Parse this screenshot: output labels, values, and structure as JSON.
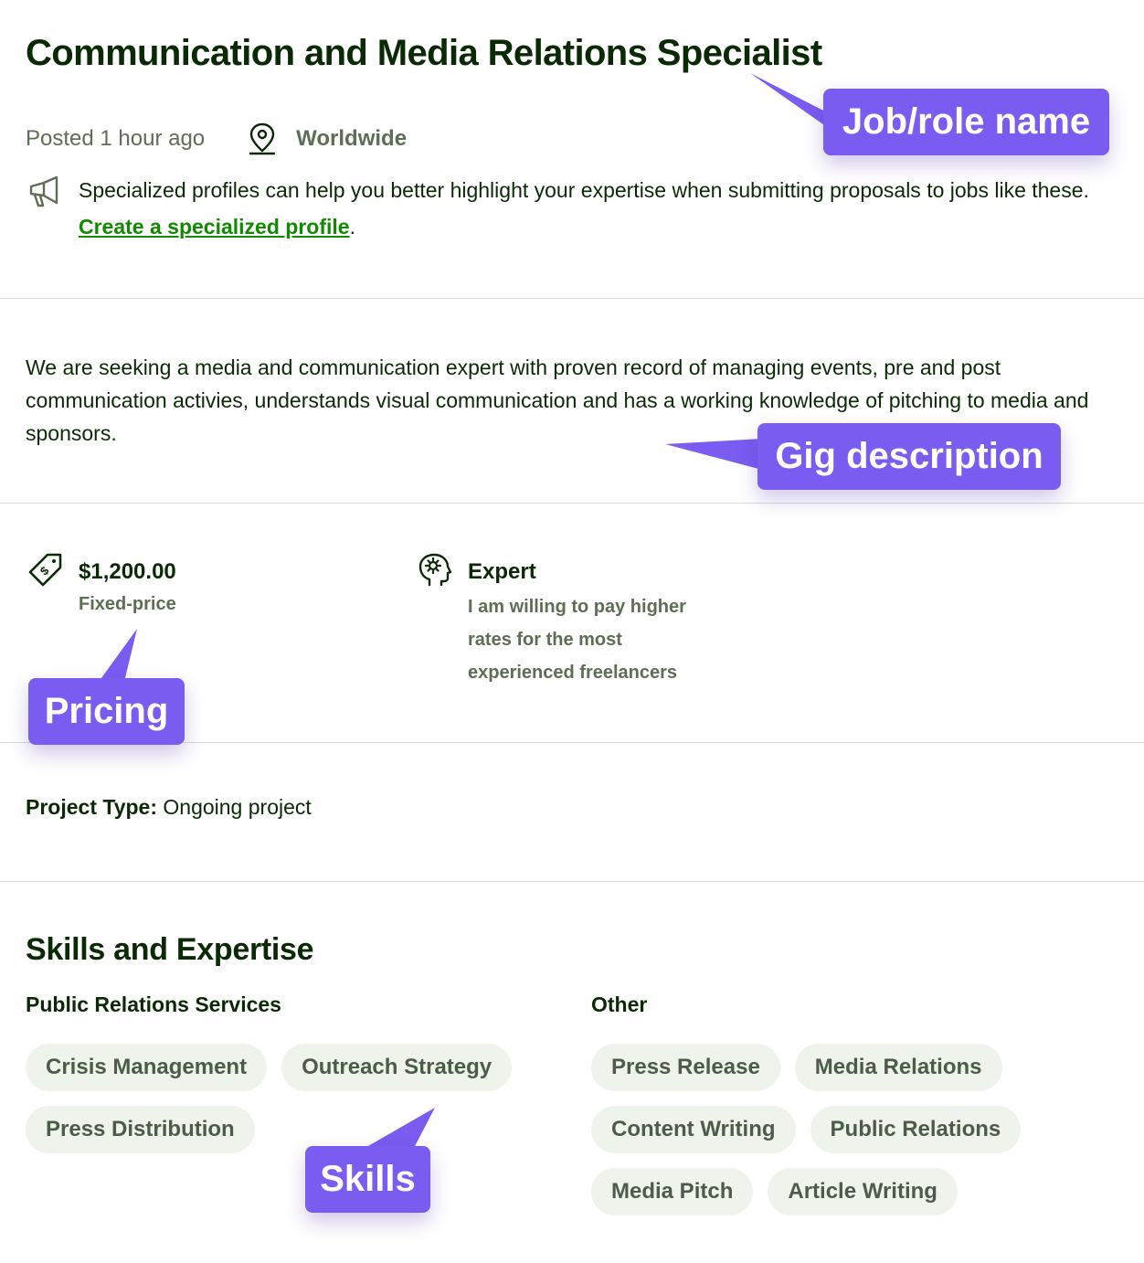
{
  "job": {
    "title": "Communication and Media Relations Specialist",
    "posted": "Posted 1 hour ago",
    "location": "Worldwide"
  },
  "promo": {
    "text": "Specialized profiles can help you better highlight your expertise when submitting proposals to jobs like these. ",
    "link": "Create a specialized profile",
    "end": "."
  },
  "description": "We are seeking a media and communication expert with proven record of managing events, pre and post communication activies,  understands visual communication and has a working knowledge of pitching to media and sponsors.",
  "pricing": {
    "amount": "$1,200.00",
    "type": "Fixed-price"
  },
  "experience": {
    "level": "Expert",
    "description": "I am willing to pay higher rates for the most experienced freelancers"
  },
  "project_type": {
    "label": "Project Type:",
    "value": " Ongoing project"
  },
  "skills": {
    "title": "Skills and Expertise",
    "groups": [
      {
        "name": "Public Relations Services",
        "items": [
          "Crisis Management",
          "Outreach Strategy",
          "Press Distribution"
        ]
      },
      {
        "name": "Other",
        "items": [
          "Press Release",
          "Media Relations",
          "Content Writing",
          "Public Relations",
          "Media Pitch",
          "Article Writing"
        ]
      }
    ]
  },
  "annotations": {
    "job_name": "Job/role name",
    "gig_description": "Gig description",
    "pricing": "Pricing",
    "skills": "Skills"
  },
  "icons": {
    "location": "map-pin-icon",
    "promo": "megaphone-icon",
    "price": "price-tag-icon",
    "level": "head-gear-icon"
  },
  "colors": {
    "link_green": "#108a00",
    "callout_purple": "#7b5cf0",
    "chip_bg": "#eef3ec",
    "text_dark": "#0a2a05",
    "text_muted": "#5e6d55"
  }
}
